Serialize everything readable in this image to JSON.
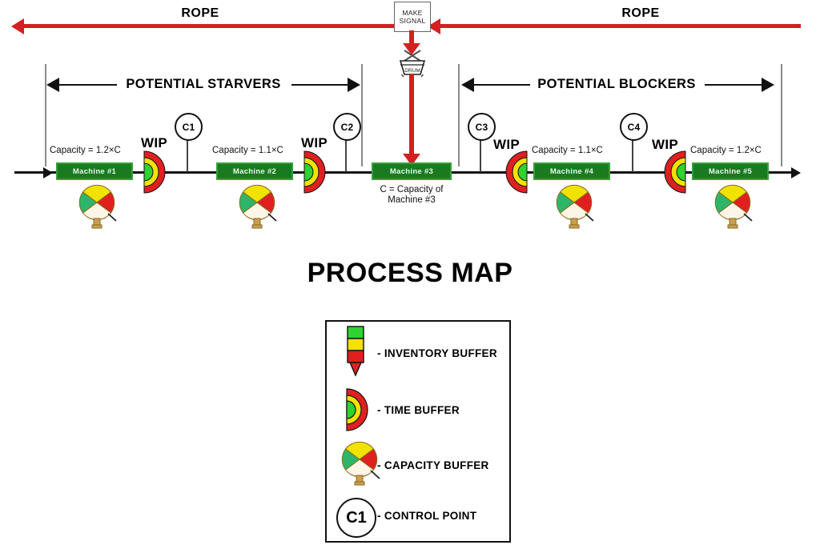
{
  "title": "PROCESS MAP",
  "rope": {
    "left_label": "ROPE",
    "right_label": "ROPE"
  },
  "signal": {
    "line1": "MAKE",
    "line2": "SIGNAL"
  },
  "drum": {
    "label": "DRUM"
  },
  "brackets": {
    "starvers": "POTENTIAL STARVERS",
    "blockers": "POTENTIAL BLOCKERS"
  },
  "machines": [
    {
      "name": "Machine #1",
      "capacity": "Capacity = 1.2×C",
      "has_capacity_buffer": true
    },
    {
      "name": "Machine #2",
      "capacity": "Capacity = 1.1×C",
      "has_capacity_buffer": true
    },
    {
      "name": "Machine #3",
      "capacity": "",
      "has_capacity_buffer": false
    },
    {
      "name": "Machine #4",
      "capacity": "Capacity = 1.1×C",
      "has_capacity_buffer": true
    },
    {
      "name": "Machine #5",
      "capacity": "Capacity = 1.2×C",
      "has_capacity_buffer": true
    }
  ],
  "constraint_note": {
    "line1": "C = Capacity of",
    "line2": "Machine #3"
  },
  "wip_label": "WIP",
  "control_points": [
    "C1",
    "C2",
    "C3",
    "C4"
  ],
  "legend": {
    "items": [
      {
        "icon": "inventory-buffer-icon",
        "label": "- INVENTORY BUFFER"
      },
      {
        "icon": "time-buffer-icon",
        "label": "- TIME BUFFER"
      },
      {
        "icon": "capacity-buffer-icon",
        "label": "- CAPACITY BUFFER"
      },
      {
        "icon": "control-point-icon",
        "label": "- CONTROL POINT",
        "badge": "C1"
      }
    ]
  },
  "colors": {
    "rope_red": "#d32020",
    "machine_fill": "#1a7a20",
    "machine_border": "#37a03a",
    "buffer_green": "#2fd22f",
    "buffer_yellow": "#f2e200",
    "buffer_red": "#e02020",
    "gauge_rim": "#c8a050",
    "bracket_gray": "#8a8a8a",
    "line_black": "#111111"
  }
}
